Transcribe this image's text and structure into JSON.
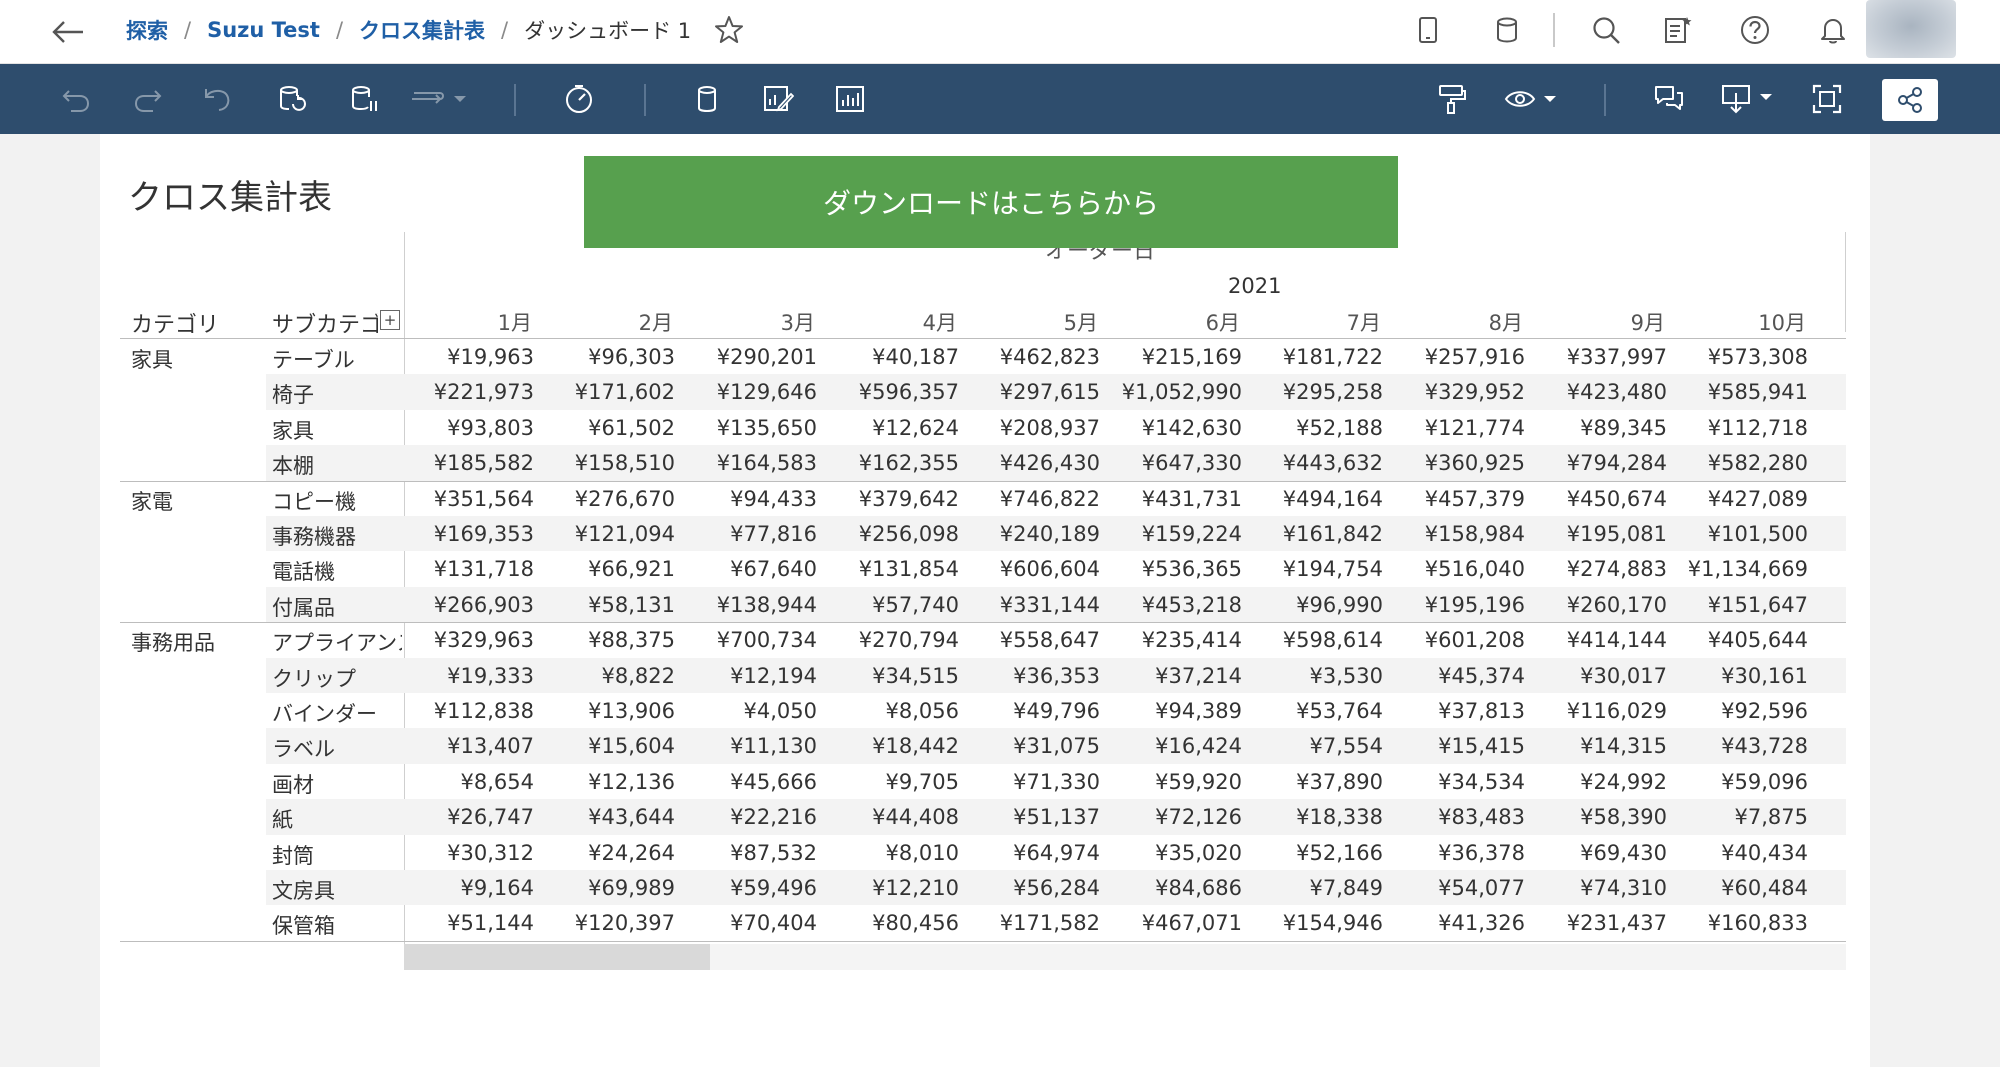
{
  "breadcrumb": {
    "items": [
      "探索",
      "Suzu Test",
      "クロス集計表"
    ],
    "current": "ダッシュボード 1",
    "separator": "/"
  },
  "icons": {
    "back": "back-arrow-icon",
    "favorite": "star-icon",
    "top_right": [
      "device-preview-icon",
      "data-source-icon",
      "search-icon",
      "recents-icon",
      "help-icon",
      "notification-bell-icon"
    ],
    "toolbar_left": [
      "undo-icon",
      "redo-icon",
      "revert-icon",
      "refresh-data-icon",
      "pause-updates-icon",
      "replay-animation-icon",
      "performance-icon",
      "data-icon",
      "edit-sheet-icon",
      "new-sheet-icon"
    ],
    "toolbar_right": [
      "format-painter-icon",
      "view-icon",
      "comment-icon",
      "download-icon",
      "fullscreen-icon",
      "share-icon"
    ]
  },
  "colors": {
    "toolbar": "#2e4d6d",
    "accent_link": "#1f5fa6",
    "download_button": "#57a04e"
  },
  "sheet": {
    "title": "クロス集計表",
    "download_button": "ダウンロードはこちらから",
    "column_field": "オーダー日",
    "year": "2021",
    "row_headers": [
      "カテゴリ",
      "サブカテゴリ"
    ],
    "months": [
      "1月",
      "2月",
      "3月",
      "4月",
      "5月",
      "6月",
      "7月",
      "8月",
      "9月",
      "10月"
    ]
  },
  "table": {
    "groups": [
      {
        "category": "家具",
        "rows": [
          {
            "sub": "テーブル",
            "values": [
              "¥19,963",
              "¥96,303",
              "¥290,201",
              "¥40,187",
              "¥462,823",
              "¥215,169",
              "¥181,722",
              "¥257,916",
              "¥337,997",
              "¥573,308"
            ]
          },
          {
            "sub": "椅子",
            "values": [
              "¥221,973",
              "¥171,602",
              "¥129,646",
              "¥596,357",
              "¥297,615",
              "¥1,052,990",
              "¥295,258",
              "¥329,952",
              "¥423,480",
              "¥585,941"
            ]
          },
          {
            "sub": "家具",
            "values": [
              "¥93,803",
              "¥61,502",
              "¥135,650",
              "¥12,624",
              "¥208,937",
              "¥142,630",
              "¥52,188",
              "¥121,774",
              "¥89,345",
              "¥112,718"
            ]
          },
          {
            "sub": "本棚",
            "values": [
              "¥185,582",
              "¥158,510",
              "¥164,583",
              "¥162,355",
              "¥426,430",
              "¥647,330",
              "¥443,632",
              "¥360,925",
              "¥794,284",
              "¥582,280"
            ]
          }
        ]
      },
      {
        "category": "家電",
        "rows": [
          {
            "sub": "コピー機",
            "values": [
              "¥351,564",
              "¥276,670",
              "¥94,433",
              "¥379,642",
              "¥746,822",
              "¥431,731",
              "¥494,164",
              "¥457,379",
              "¥450,674",
              "¥427,089"
            ]
          },
          {
            "sub": "事務機器",
            "values": [
              "¥169,353",
              "¥121,094",
              "¥77,816",
              "¥256,098",
              "¥240,189",
              "¥159,224",
              "¥161,842",
              "¥158,984",
              "¥195,081",
              "¥101,500"
            ]
          },
          {
            "sub": "電話機",
            "values": [
              "¥131,718",
              "¥66,921",
              "¥67,640",
              "¥131,854",
              "¥606,604",
              "¥536,365",
              "¥194,754",
              "¥516,040",
              "¥274,883",
              "¥1,134,669"
            ]
          },
          {
            "sub": "付属品",
            "values": [
              "¥266,903",
              "¥58,131",
              "¥138,944",
              "¥57,740",
              "¥331,144",
              "¥453,218",
              "¥96,990",
              "¥195,196",
              "¥260,170",
              "¥151,647"
            ]
          }
        ]
      },
      {
        "category": "事務用品",
        "rows": [
          {
            "sub": "アプライアンス",
            "values": [
              "¥329,963",
              "¥88,375",
              "¥700,734",
              "¥270,794",
              "¥558,647",
              "¥235,414",
              "¥598,614",
              "¥601,208",
              "¥414,144",
              "¥405,644"
            ]
          },
          {
            "sub": "クリップ",
            "values": [
              "¥19,333",
              "¥8,822",
              "¥12,194",
              "¥34,515",
              "¥36,353",
              "¥37,214",
              "¥3,530",
              "¥45,374",
              "¥30,017",
              "¥30,161"
            ]
          },
          {
            "sub": "バインダー",
            "values": [
              "¥112,838",
              "¥13,906",
              "¥4,050",
              "¥8,056",
              "¥49,796",
              "¥94,389",
              "¥53,764",
              "¥37,813",
              "¥116,029",
              "¥92,596"
            ]
          },
          {
            "sub": "ラベル",
            "values": [
              "¥13,407",
              "¥15,604",
              "¥11,130",
              "¥18,442",
              "¥31,075",
              "¥16,424",
              "¥7,554",
              "¥15,415",
              "¥14,315",
              "¥43,728"
            ]
          },
          {
            "sub": "画材",
            "values": [
              "¥8,654",
              "¥12,136",
              "¥45,666",
              "¥9,705",
              "¥71,330",
              "¥59,920",
              "¥37,890",
              "¥34,534",
              "¥24,992",
              "¥59,096"
            ]
          },
          {
            "sub": "紙",
            "values": [
              "¥26,747",
              "¥43,644",
              "¥22,216",
              "¥44,408",
              "¥51,137",
              "¥72,126",
              "¥18,338",
              "¥83,483",
              "¥58,390",
              "¥7,875"
            ]
          },
          {
            "sub": "封筒",
            "values": [
              "¥30,312",
              "¥24,264",
              "¥87,532",
              "¥8,010",
              "¥64,974",
              "¥35,020",
              "¥52,166",
              "¥36,378",
              "¥69,430",
              "¥40,434"
            ]
          },
          {
            "sub": "文房具",
            "values": [
              "¥9,164",
              "¥69,989",
              "¥59,496",
              "¥12,210",
              "¥56,284",
              "¥84,686",
              "¥7,849",
              "¥54,077",
              "¥74,310",
              "¥60,484"
            ]
          },
          {
            "sub": "保管箱",
            "values": [
              "¥51,144",
              "¥120,397",
              "¥70,404",
              "¥80,456",
              "¥171,582",
              "¥467,071",
              "¥154,946",
              "¥41,326",
              "¥231,437",
              "¥160,833"
            ]
          }
        ]
      }
    ]
  }
}
